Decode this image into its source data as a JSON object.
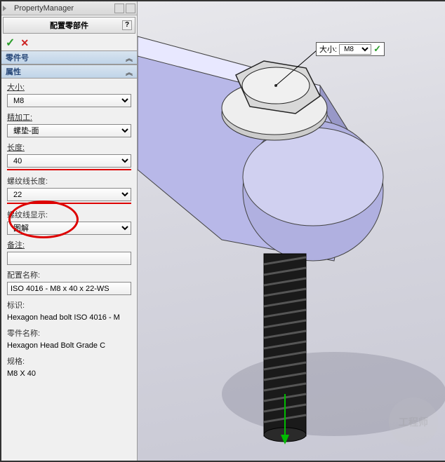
{
  "header": {
    "title": "PropertyManager"
  },
  "config_bar": {
    "title": "配置零部件",
    "help": "?"
  },
  "buttons": {
    "ok": "✓",
    "cancel": "✕"
  },
  "sections": {
    "part_number": {
      "title": "零件号",
      "chevron": "︽"
    },
    "properties": {
      "title": "属性",
      "chevron": "︽"
    }
  },
  "fields": {
    "size": {
      "label": "大小:",
      "value": "M8"
    },
    "finish": {
      "label": "精加工:",
      "value": "螺垫-面"
    },
    "length": {
      "label": "长度:",
      "value": "40"
    },
    "thread_len": {
      "label": "螺纹线长度:",
      "value": "22"
    },
    "thread_disp": {
      "label": "螺纹线显示:",
      "value": "图解"
    },
    "remark": {
      "label": "备注:",
      "value": ""
    },
    "config_name": {
      "label": "配置名称:",
      "value": "ISO 4016 - M8 x 40 x 22-WS"
    },
    "ident": {
      "label": "标识:",
      "value": "Hexagon head bolt ISO 4016 - M"
    },
    "part_name": {
      "label": "零件名称:",
      "value": "Hexagon Head Bolt Grade C"
    },
    "spec": {
      "label": "规格:",
      "value": "M8 X 40"
    }
  },
  "callout": {
    "label": "大小:",
    "value": "M8",
    "ok": "✓"
  },
  "watermark": "工程师"
}
